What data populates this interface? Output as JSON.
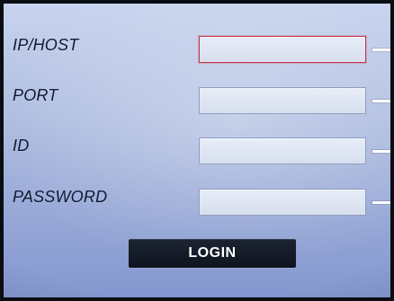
{
  "login_form": {
    "fields": [
      {
        "label": "IP/HOST",
        "value": "",
        "placeholder": ""
      },
      {
        "label": "PORT",
        "value": "",
        "placeholder": ""
      },
      {
        "label": "ID",
        "value": "",
        "placeholder": ""
      },
      {
        "label": "PASSWORD",
        "value": "",
        "placeholder": ""
      }
    ],
    "login_button": "LOGIN"
  }
}
